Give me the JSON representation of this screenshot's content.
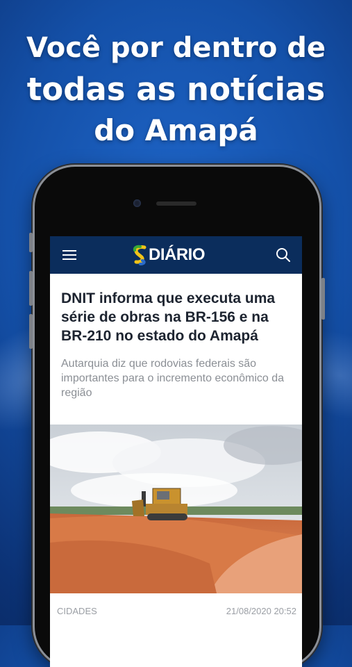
{
  "promo": {
    "line1": "Você por dentro de",
    "line2": "todas as notícias",
    "line3": "do Amapá"
  },
  "app": {
    "logo_text": "DIÁRIO",
    "brand_colors": {
      "appbar": "#0b2d5c",
      "logo_green": "#3aa935",
      "logo_yellow": "#f2c318",
      "logo_blue": "#2a6ac8"
    }
  },
  "article": {
    "title": "DNIT informa que executa uma série de obras na BR-156 e na BR-210 no estado do Amapá",
    "subtitle": "Autarquia diz que rodovias federais são importantes para o incremento econômico da região",
    "category": "CIDADES",
    "datetime": "21/08/2020 20:52"
  },
  "icons": [
    "menu-icon",
    "search-icon"
  ]
}
